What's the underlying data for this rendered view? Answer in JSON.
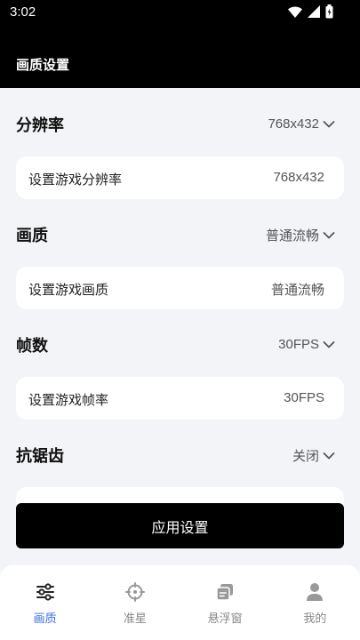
{
  "status_bar": {
    "time": "3:02"
  },
  "header": {
    "title": "画质设置"
  },
  "sections": [
    {
      "title": "分辨率",
      "dropdown_value": "768x432",
      "card_label": "设置游戏分辨率",
      "card_value": "768x432"
    },
    {
      "title": "画质",
      "dropdown_value": "普通流畅",
      "card_label": "设置游戏画质",
      "card_value": "普通流畅"
    },
    {
      "title": "帧数",
      "dropdown_value": "30FPS",
      "card_label": "设置游戏帧率",
      "card_value": "30FPS"
    },
    {
      "title": "抗锯齿",
      "dropdown_value": "关闭"
    }
  ],
  "apply_button": {
    "label": "应用设置"
  },
  "bottom_nav": {
    "items": [
      {
        "label": "画质",
        "icon": "sliders-icon",
        "active": true
      },
      {
        "label": "准星",
        "icon": "crosshair-icon"
      },
      {
        "label": "悬浮窗",
        "icon": "floating-window-icon"
      },
      {
        "label": "我的",
        "icon": "user-icon"
      }
    ]
  },
  "colors": {
    "header_bg": "#000000",
    "accent": "#3a6ee8",
    "page_bg": "#f3f4f7"
  }
}
